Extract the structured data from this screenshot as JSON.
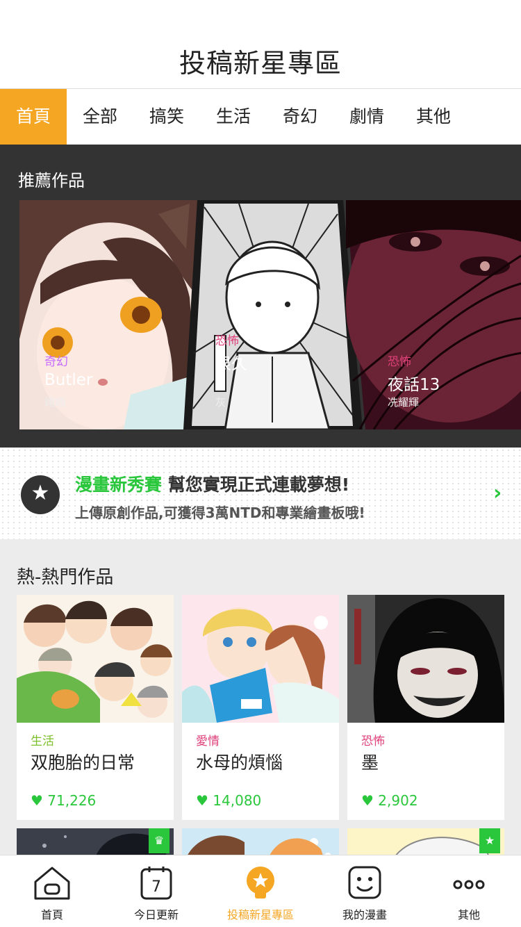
{
  "header": {
    "title": "投稿新星專區"
  },
  "tabs": [
    "首頁",
    "全部",
    "搞笑",
    "生活",
    "奇幻",
    "劇情",
    "其他"
  ],
  "recommend": {
    "title": "推薦作品",
    "cards": [
      {
        "genre": "奇幻",
        "name": "Butler",
        "author": "翊翊",
        "genre_color": "#c86bff"
      },
      {
        "genre": "恐怖",
        "name": "很久",
        "author": "灰",
        "genre_color": "#e0407a"
      },
      {
        "genre": "恐怖",
        "name": "夜話13",
        "author": "冼耀輝",
        "genre_color": "#e0407a"
      }
    ]
  },
  "banner": {
    "highlight": "漫畫新秀賽",
    "headline": " 幫您實現正式連載夢想!",
    "subline": "上傳原創作品,可獲得3萬NTD和專業繪畫板哦!"
  },
  "hot": {
    "title": "熱-熱門作品",
    "items": [
      {
        "genre": "生活",
        "name": "双胞胎的日常",
        "likes": "71,226",
        "genre_color": "#7bbf2a"
      },
      {
        "genre": "愛情",
        "name": "水母的煩惱",
        "likes": "14,080",
        "genre_color": "#e0407a"
      },
      {
        "genre": "恐怖",
        "name": "墨",
        "likes": "2,902",
        "genre_color": "#e0407a"
      }
    ]
  },
  "bottom_nav": [
    {
      "label": "首頁",
      "icon": "home-icon"
    },
    {
      "label": "今日更新",
      "icon": "calendar-icon",
      "icon_text": "7"
    },
    {
      "label": "投稿新星專區",
      "icon": "lightbulb-star-icon"
    },
    {
      "label": "我的漫畫",
      "icon": "smiley-icon"
    },
    {
      "label": "其他",
      "icon": "more-icon"
    }
  ],
  "colors": {
    "accent": "#f5a623",
    "green": "#2ac73d",
    "dark": "#333333"
  }
}
